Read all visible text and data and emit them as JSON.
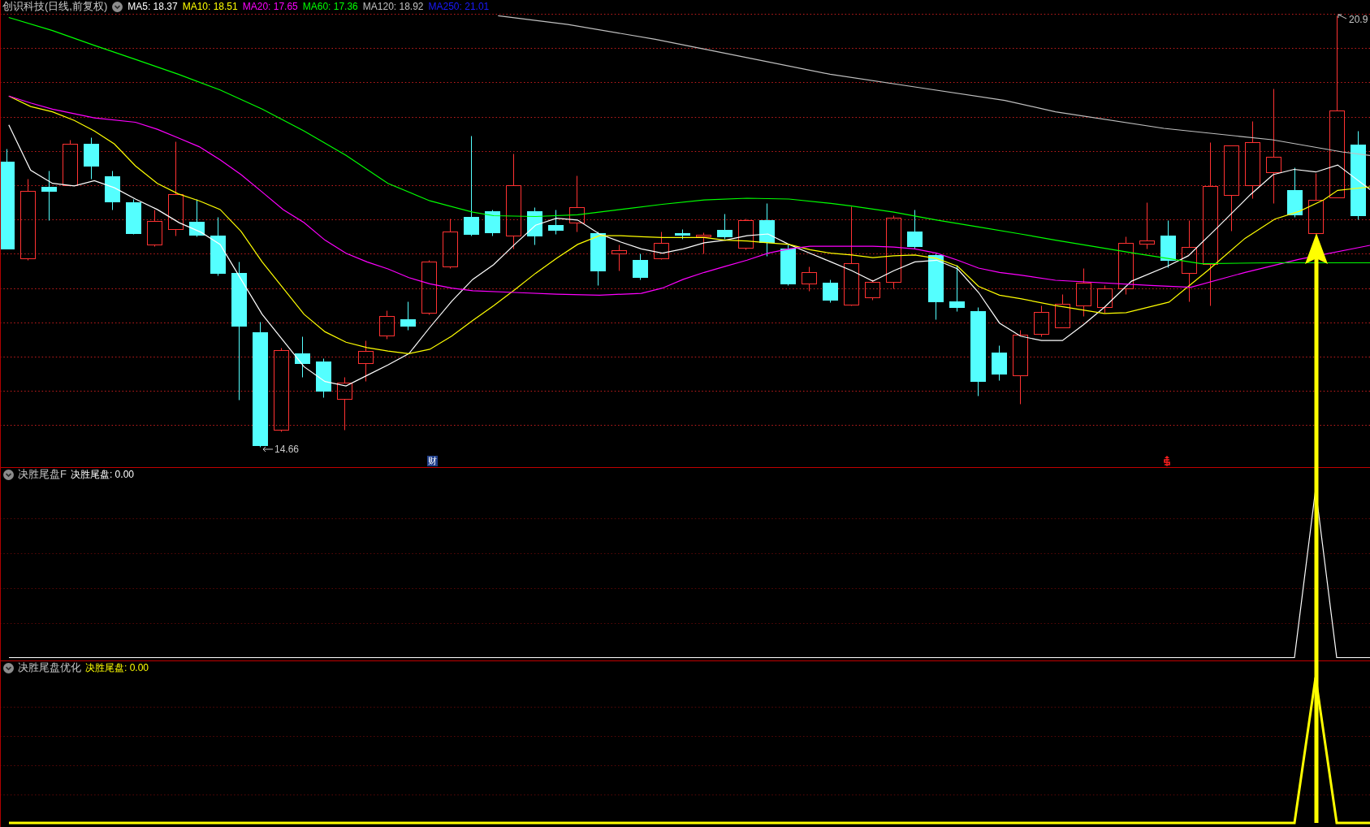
{
  "main_panel": {
    "title": "创识科技(日线,前复权)",
    "indicators": [
      {
        "text": "MA5: 18.37",
        "color": "#ffffff"
      },
      {
        "text": "MA10: 18.51",
        "color": "#ffff00"
      },
      {
        "text": "MA20: 17.65",
        "color": "#ff00ff"
      },
      {
        "text": "MA60: 17.36",
        "color": "#00ff00"
      },
      {
        "text": "MA120: 18.92",
        "color": "#c0c0c0"
      },
      {
        "text": "MA250: 21.01",
        "color": "#1a1aff"
      }
    ],
    "high_label": "20.9",
    "low_label": "14.66",
    "finance_marker": "财"
  },
  "indicator_panels": [
    {
      "name": "决胜尾盘F",
      "output": "决胜尾盘: 0.00",
      "color": "#ffffff"
    },
    {
      "name": "决胜尾盘优化",
      "output": "决胜尾盘: 0.00",
      "color": "#ffff00"
    }
  ]
}
